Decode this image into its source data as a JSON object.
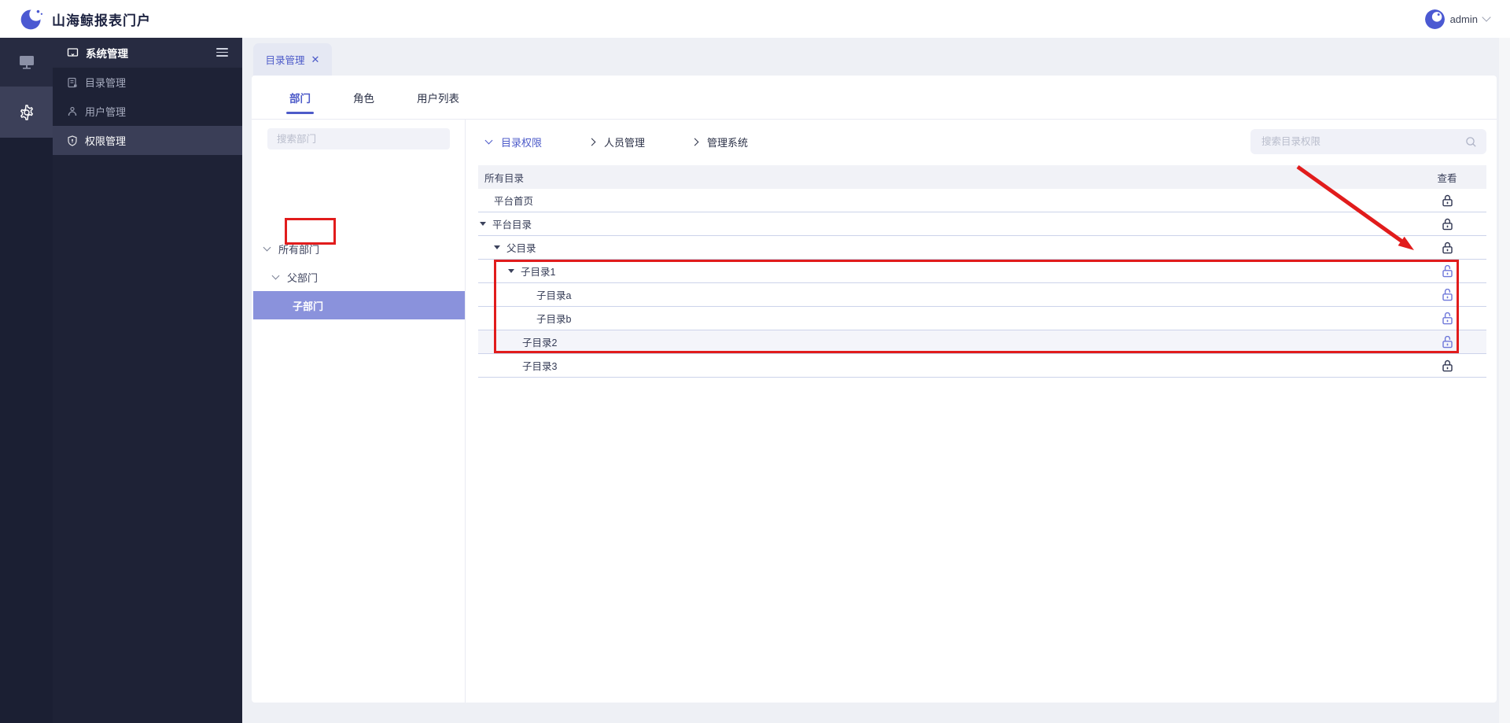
{
  "topbar": {
    "title": "山海鲸报表门户",
    "user": {
      "name": "admin"
    }
  },
  "rail": {
    "items": [
      {
        "icon": "monitor-icon",
        "active": false
      },
      {
        "icon": "gear-icon",
        "active": true
      }
    ]
  },
  "sidebar": {
    "header": {
      "label": "系统管理",
      "icon": "display-icon",
      "menu_icon": "hamburger-icon"
    },
    "items": [
      {
        "label": "目录管理",
        "icon": "catalog-icon",
        "active": false
      },
      {
        "label": "用户管理",
        "icon": "users-icon",
        "active": false
      },
      {
        "label": "权限管理",
        "icon": "shield-icon",
        "active": true
      }
    ]
  },
  "tabstrip": {
    "active_tab": {
      "label": "目录管理",
      "closable": true
    }
  },
  "card": {
    "tabs": [
      {
        "label": "部门",
        "active": true
      },
      {
        "label": "角色",
        "active": false
      },
      {
        "label": "用户列表",
        "active": false
      }
    ],
    "department_panel": {
      "search_placeholder": "搜索部门",
      "tree": [
        {
          "label": "所有部门",
          "level": 0,
          "expanded": true,
          "selected": false
        },
        {
          "label": "父部门",
          "level": 1,
          "expanded": true,
          "selected": false
        },
        {
          "label": "子部门",
          "level": 2,
          "expanded": false,
          "selected": true,
          "annotated": true
        }
      ]
    },
    "permission_panel": {
      "sections": [
        {
          "label": "目录权限",
          "expanded": true,
          "active": true
        },
        {
          "label": "人员管理",
          "expanded": false,
          "active": false
        },
        {
          "label": "管理系统",
          "expanded": false,
          "active": false
        }
      ],
      "search_placeholder": "搜索目录权限",
      "table": {
        "column_left": "所有目录",
        "column_right": "查看",
        "rows": [
          {
            "label": "平台首页",
            "level": 0,
            "expandable": false,
            "lock": "locked",
            "highlighted": false
          },
          {
            "label": "平台目录",
            "level": 0,
            "expandable": true,
            "lock": "locked",
            "highlighted": false
          },
          {
            "label": "父目录",
            "level": 1,
            "expandable": true,
            "lock": "locked",
            "highlighted": false
          },
          {
            "label": "子目录1",
            "level": 2,
            "expandable": true,
            "lock": "unlocked",
            "highlighted": false
          },
          {
            "label": "子目录a",
            "level": 3,
            "expandable": false,
            "lock": "unlocked",
            "highlighted": false
          },
          {
            "label": "子目录b",
            "level": 3,
            "expandable": false,
            "lock": "unlocked",
            "highlighted": false
          },
          {
            "label": "子目录2",
            "level": 2,
            "expandable": false,
            "lock": "unlocked",
            "highlighted": true
          },
          {
            "label": "子目录3",
            "level": 2,
            "expandable": false,
            "lock": "locked",
            "highlighted": false
          }
        ]
      }
    }
  },
  "annotations": {
    "color": "#e11c1c",
    "tree_box_target": "子部门",
    "table_box_targets": [
      "子目录1",
      "子目录a",
      "子目录b",
      "子目录2"
    ],
    "arrow_target": "子目录1 查看 lock"
  },
  "colors": {
    "accent": "#4d5bc9",
    "selected_row_purple": "#8a92dc",
    "annotation_red": "#e11c1c",
    "lock_locked": "#2e3450",
    "lock_unlocked": "#6d76d9"
  }
}
